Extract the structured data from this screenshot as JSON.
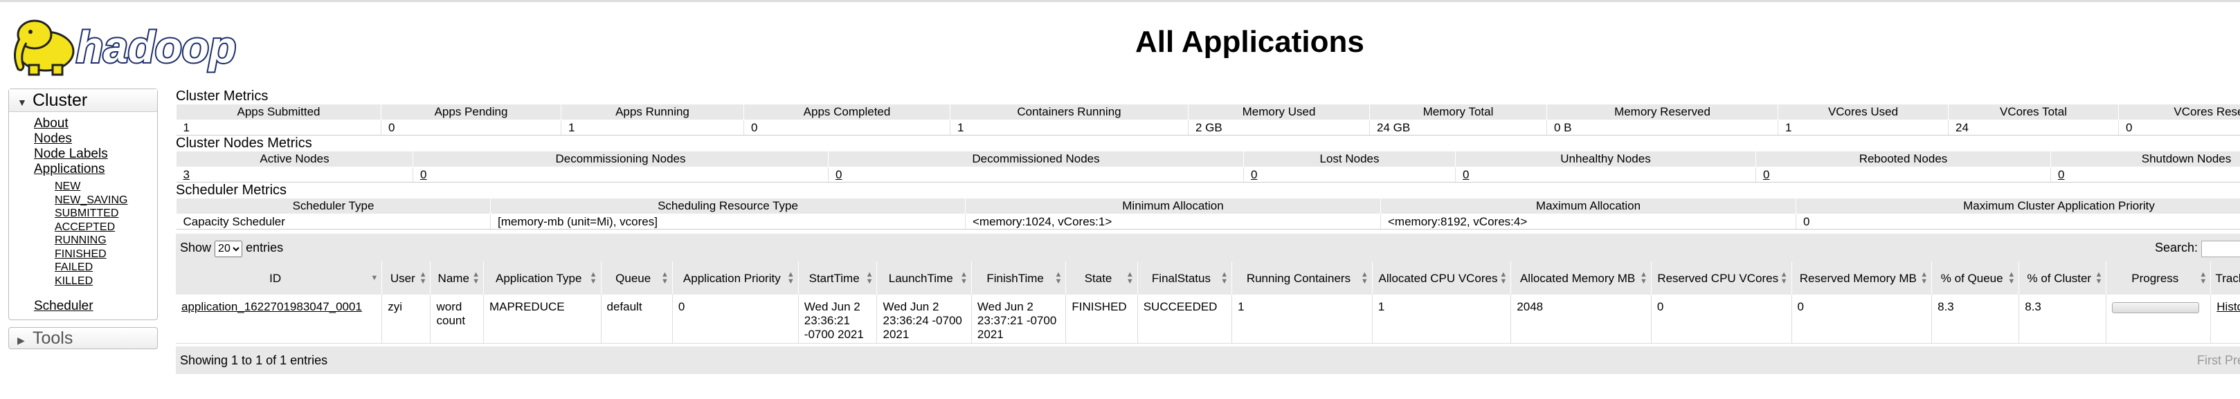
{
  "header": {
    "logo_text": "hadoop",
    "title": "All Applications"
  },
  "nav": {
    "cluster_label": "Cluster",
    "cluster_links": [
      "About",
      "Nodes",
      "Node Labels",
      "Applications"
    ],
    "app_states": [
      "NEW",
      "NEW_SAVING",
      "SUBMITTED",
      "ACCEPTED",
      "RUNNING",
      "FINISHED",
      "FAILED",
      "KILLED"
    ],
    "scheduler_label": "Scheduler",
    "tools_label": "Tools"
  },
  "cluster_metrics": {
    "title": "Cluster Metrics",
    "headers": [
      "Apps Submitted",
      "Apps Pending",
      "Apps Running",
      "Apps Completed",
      "Containers Running",
      "Memory Used",
      "Memory Total",
      "Memory Reserved",
      "VCores Used",
      "VCores Total",
      "VCores Reserved"
    ],
    "values": [
      "1",
      "0",
      "1",
      "0",
      "1",
      "2 GB",
      "24 GB",
      "0 B",
      "1",
      "24",
      "0"
    ]
  },
  "nodes_metrics": {
    "title": "Cluster Nodes Metrics",
    "headers": [
      "Active Nodes",
      "Decommissioning Nodes",
      "Decommissioned Nodes",
      "Lost Nodes",
      "Unhealthy Nodes",
      "Rebooted Nodes",
      "Shutdown Nodes"
    ],
    "values": [
      "3",
      "0",
      "0",
      "0",
      "0",
      "0",
      "0"
    ]
  },
  "scheduler_metrics": {
    "title": "Scheduler Metrics",
    "headers": [
      "Scheduler Type",
      "Scheduling Resource Type",
      "Minimum Allocation",
      "Maximum Allocation",
      "Maximum Cluster Application Priority"
    ],
    "values": [
      "Capacity Scheduler",
      "[memory-mb (unit=Mi), vcores]",
      "<memory:1024, vCores:1>",
      "<memory:8192, vCores:4>",
      "0"
    ]
  },
  "apps_table": {
    "show_label": "Show",
    "page_size": "20",
    "entries_label": "entries",
    "search_label": "Search:",
    "columns": [
      "ID",
      "User",
      "Name",
      "Application Type",
      "Queue",
      "Application Priority",
      "StartTime",
      "LaunchTime",
      "FinishTime",
      "State",
      "FinalStatus",
      "Running Containers",
      "Allocated CPU VCores",
      "Allocated Memory MB",
      "Reserved CPU VCores",
      "Reserved Memory MB",
      "% of Queue",
      "% of Cluster",
      "Progress",
      "Tracking UI"
    ],
    "rows": [
      {
        "id": "application_1622701983047_0001",
        "user": "zyi",
        "name": "word count",
        "type": "MAPREDUCE",
        "queue": "default",
        "priority": "0",
        "start": "Wed Jun 2 23:36:21 -0700 2021",
        "launch": "Wed Jun 2 23:36:24 -0700 2021",
        "finish": "Wed Jun 2 23:37:21 -0700 2021",
        "state": "FINISHED",
        "final_status": "SUCCEEDED",
        "running_containers": "1",
        "alloc_cpu": "1",
        "alloc_mem": "2048",
        "res_cpu": "0",
        "res_mem": "0",
        "pct_queue": "8.3",
        "pct_cluster": "8.3",
        "progress": 1.0,
        "tracking": "History"
      }
    ],
    "info": "Showing 1 to 1 of 1 entries",
    "pager_first": "First",
    "pager_prev": "Previous"
  }
}
